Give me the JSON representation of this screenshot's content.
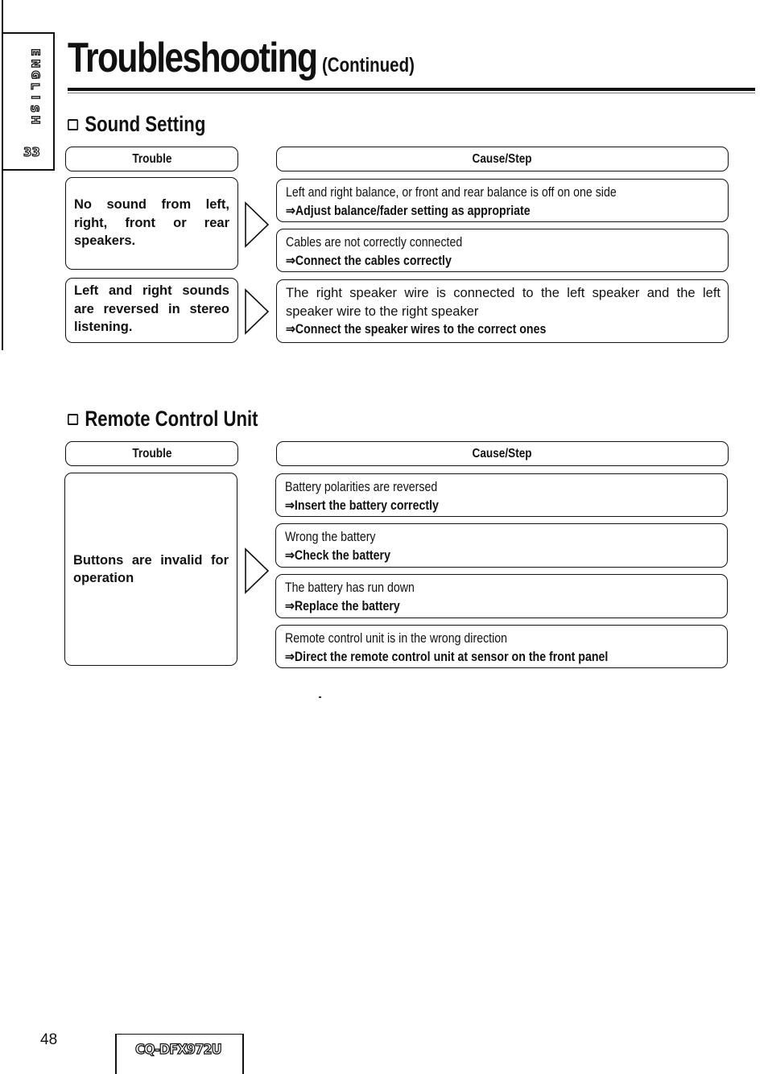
{
  "side_tab": {
    "language_letters": [
      "E",
      "N",
      "G",
      "L",
      "I",
      "S",
      "H"
    ],
    "section_number": "33"
  },
  "header": {
    "title": "Troubleshooting",
    "subtitle": "(Continued)"
  },
  "sections": [
    {
      "title": "Sound Setting",
      "icon": "checkbox-square-icon",
      "col_trouble": "Trouble",
      "col_cause": "Cause/Step",
      "groups": [
        {
          "trouble": "No sound from left, right, front or rear speakers.",
          "causes": [
            {
              "cause": "Left and right balance, or front and rear balance is off on one side",
              "step": "⇒Adjust balance/fader setting as appropriate"
            },
            {
              "cause": "Cables are not correctly connected",
              "step": "⇒Connect the cables correctly"
            }
          ]
        },
        {
          "trouble": "Left and right sounds are reversed in stereo listening.",
          "causes": [
            {
              "cause": "The right speaker wire is connected to the left speaker and the left speaker wire to the right speaker",
              "step": "⇒Connect the speaker wires to the correct ones"
            }
          ]
        }
      ]
    },
    {
      "title": "Remote Control Unit",
      "icon": "checkbox-square-icon",
      "col_trouble": "Trouble",
      "col_cause": "Cause/Step",
      "groups": [
        {
          "trouble": "Buttons are invalid for operation",
          "causes": [
            {
              "cause": "Battery polarities are reversed",
              "step": "⇒Insert the battery correctly"
            },
            {
              "cause": "Wrong the battery",
              "step": "⇒Check the battery"
            },
            {
              "cause": "The battery has run down",
              "step": "⇒Replace the battery"
            },
            {
              "cause": "Remote control unit is in the wrong direction",
              "step": "⇒Direct the remote control unit at sensor on the front panel"
            }
          ]
        }
      ]
    }
  ],
  "footer": {
    "page_number": "48",
    "model": "CQ-DFX972U"
  }
}
